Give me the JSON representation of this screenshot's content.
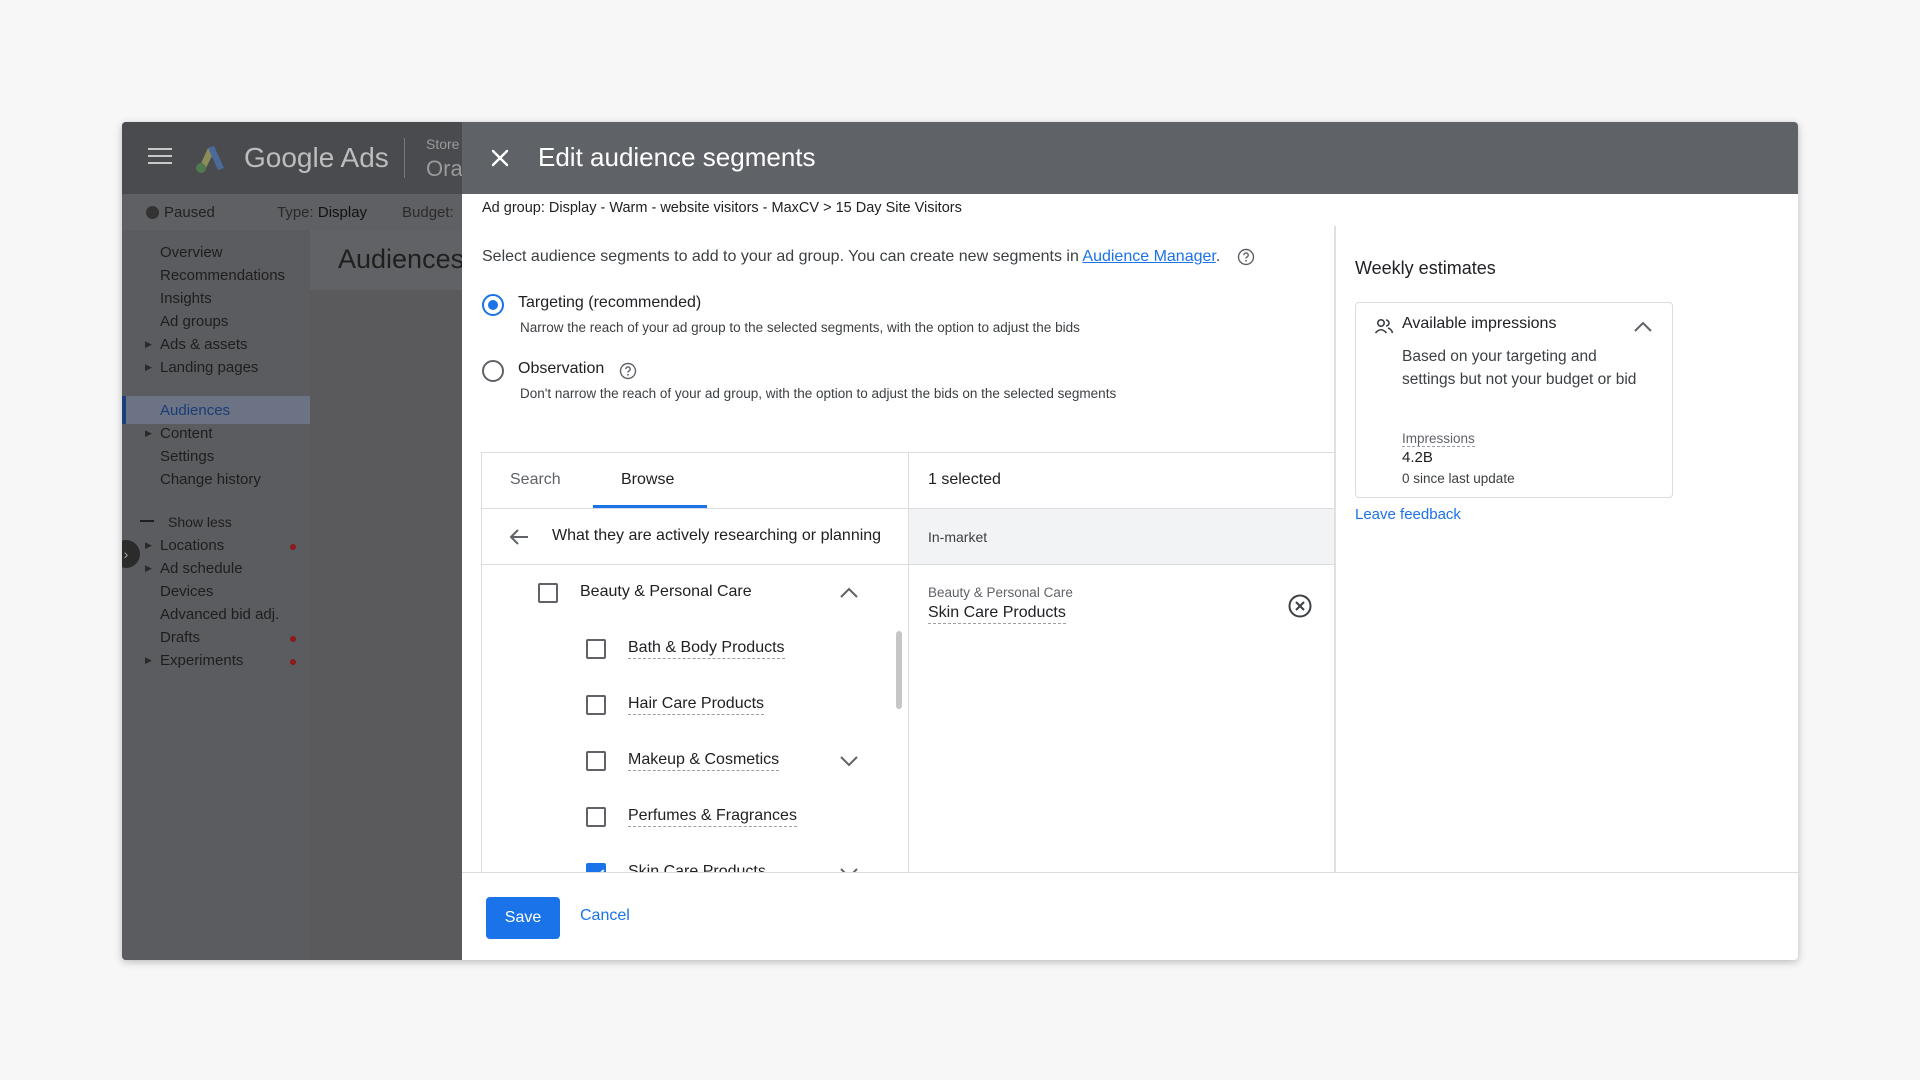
{
  "app": {
    "name": "Google Ads",
    "store_label": "Store",
    "store_name": "Ora",
    "status": "Paused",
    "type_label": "Type:",
    "type_value": "Display",
    "budget_label": "Budget:",
    "page_title": "Audiences"
  },
  "nav": {
    "items": [
      {
        "label": "Overview"
      },
      {
        "label": "Recommendations"
      },
      {
        "label": "Insights"
      },
      {
        "label": "Ad groups"
      },
      {
        "label": "Ads & assets"
      },
      {
        "label": "Landing pages"
      },
      {
        "label": "Audiences"
      },
      {
        "label": "Content"
      },
      {
        "label": "Settings"
      },
      {
        "label": "Change history"
      }
    ],
    "show_less": "Show less",
    "more_items": [
      {
        "label": "Locations"
      },
      {
        "label": "Ad schedule"
      },
      {
        "label": "Devices"
      },
      {
        "label": "Advanced bid adj."
      },
      {
        "label": "Drafts"
      },
      {
        "label": "Experiments"
      }
    ]
  },
  "panel": {
    "title": "Edit audience segments",
    "breadcrumb": "Ad group: Display - Warm - website visitors - MaxCV > 15 Day Site Visitors",
    "intro_text": "Select audience segments to add to your ad group. You can create new segments in",
    "intro_link": "Audience Manager",
    "intro_end": ".",
    "targeting": {
      "label": "Targeting (recommended)",
      "desc": "Narrow the reach of your ad group to the selected segments, with the option to adjust the bids"
    },
    "observation": {
      "label": "Observation",
      "desc": "Don't narrow the reach of your ad group, with the option to adjust the bids on the selected segments"
    },
    "tabs": {
      "search": "Search",
      "browse": "Browse"
    },
    "category": "What they are actively researching or planning",
    "parent_item": "Beauty & Personal Care",
    "items": [
      {
        "label": "Bath & Body Products"
      },
      {
        "label": "Hair Care Products"
      },
      {
        "label": "Makeup & Cosmetics"
      },
      {
        "label": "Perfumes & Fragrances"
      },
      {
        "label": "Skin Care Products"
      }
    ],
    "selected": {
      "count": "1 selected",
      "type": "In-market",
      "parent": "Beauty & Personal Care",
      "name": "Skin Care Products"
    },
    "estimates": {
      "title": "Weekly estimates",
      "card_title": "Available impressions",
      "desc": "Based on your targeting and settings but not your budget or bid",
      "metric": "Impressions",
      "value": "4.2B",
      "since": "0 since last update",
      "feedback": "Leave feedback"
    },
    "save": "Save",
    "cancel": "Cancel"
  },
  "colors": {
    "accent": "#1a73e8",
    "header": "#5f6368"
  }
}
